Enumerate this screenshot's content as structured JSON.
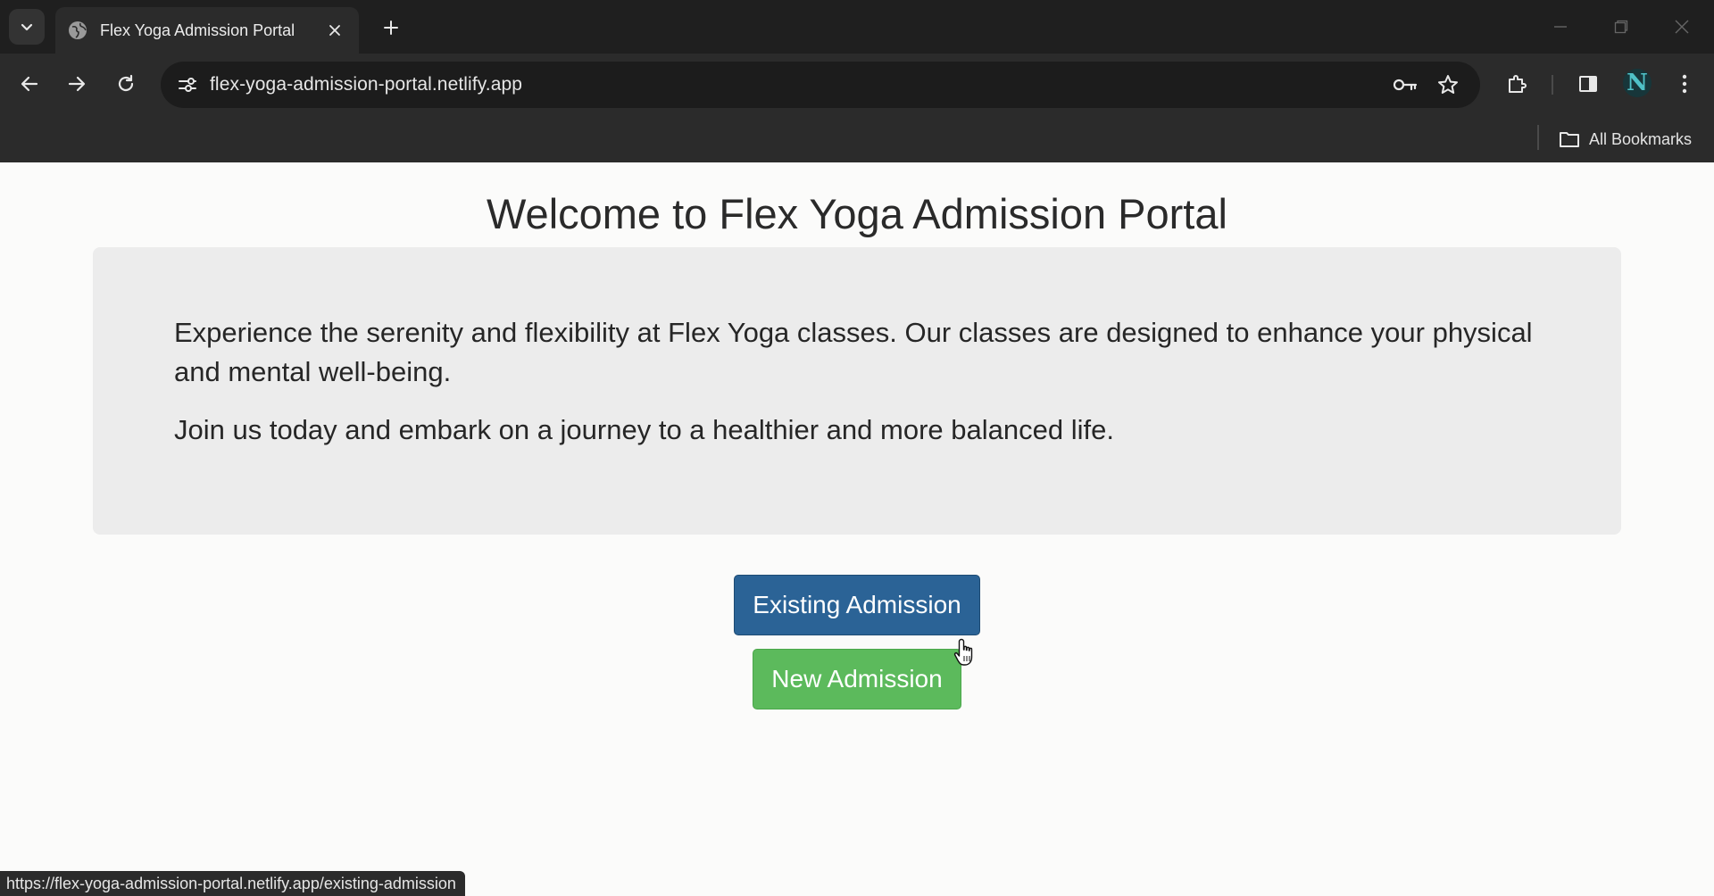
{
  "browser": {
    "tab": {
      "title": "Flex Yoga Admission Portal"
    },
    "address_bar": {
      "url": "flex-yoga-admission-portal.netlify.app"
    },
    "bookmarks_bar": {
      "all_bookmarks_label": "All Bookmarks"
    },
    "profile_initial": "N",
    "status_url": "https://flex-yoga-admission-portal.netlify.app/existing-admission"
  },
  "page": {
    "title": "Welcome to Flex Yoga Admission Portal",
    "intro_paragraph_1": "Experience the serenity and flexibility at Flex Yoga classes. Our classes are designed to enhance your physical and mental well-being.",
    "intro_paragraph_2": "Join us today and embark on a journey to a healthier and more balanced life.",
    "buttons": {
      "existing_admission": "Existing Admission",
      "new_admission": "New Admission"
    }
  },
  "colors": {
    "existing_button": "#2b6396",
    "new_button": "#5cba5c",
    "panel_background": "#ececec",
    "browser_frame": "#2b2b2b"
  },
  "icons": [
    "tab-search-icon",
    "globe-icon",
    "close-icon",
    "plus-icon",
    "minimize-icon",
    "restore-icon",
    "back-arrow-icon",
    "forward-arrow-icon",
    "reload-icon",
    "site-settings-icon",
    "password-key-icon",
    "star-icon",
    "extensions-puzzle-icon",
    "side-panel-icon",
    "kebab-menu-icon",
    "folder-icon",
    "hand-pointer-cursor-icon"
  ]
}
